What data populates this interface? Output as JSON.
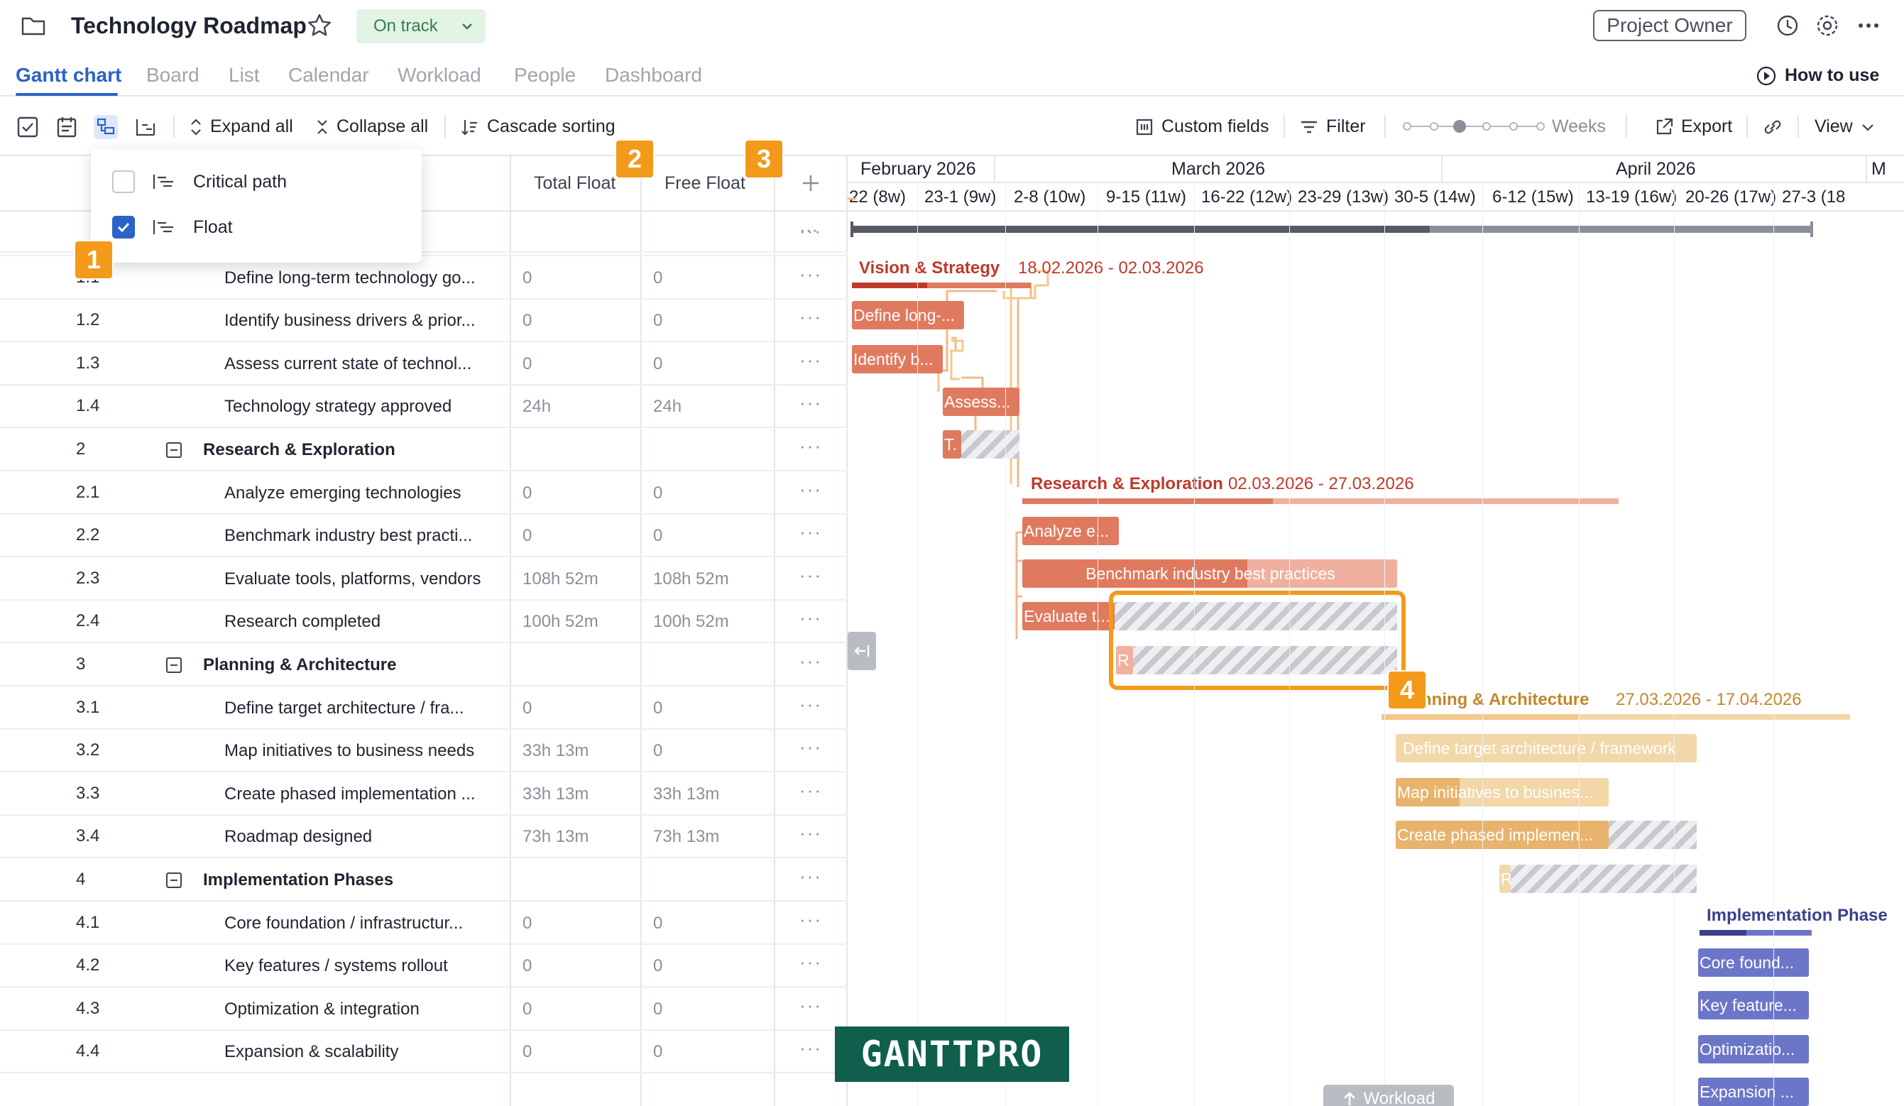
{
  "header": {
    "title": "Technology Roadmap",
    "status": "On track",
    "owner_button": "Project Owner"
  },
  "tabs": [
    "Gantt chart",
    "Board",
    "List",
    "Calendar",
    "Workload",
    "People",
    "Dashboard"
  ],
  "how_to_use": "How to use",
  "toolbar": {
    "expand_all": "Expand all",
    "collapse_all": "Collapse all",
    "cascade_sorting": "Cascade sorting",
    "custom_fields": "Custom fields",
    "filter": "Filter",
    "zoom_label": "Weeks",
    "export": "Export",
    "view": "View"
  },
  "dropdown": {
    "items": [
      {
        "label": "Critical path",
        "checked": false
      },
      {
        "label": "Float",
        "checked": true
      }
    ]
  },
  "columns": {
    "total_float": "Total Float",
    "free_float": "Free Float"
  },
  "badges": [
    "1",
    "2",
    "3",
    "4"
  ],
  "rows": [
    {
      "num": "",
      "name": "Vision & Strategy",
      "group": true,
      "tf": "",
      "ff": ""
    },
    {
      "num": "1.1",
      "name": "Define long-term technology go...",
      "group": false,
      "tf": "0",
      "ff": "0"
    },
    {
      "num": "1.2",
      "name": "Identify business drivers & prior...",
      "group": false,
      "tf": "0",
      "ff": "0"
    },
    {
      "num": "1.3",
      "name": "Assess current state of technol...",
      "group": false,
      "tf": "0",
      "ff": "0"
    },
    {
      "num": "1.4",
      "name": "Technology strategy approved",
      "group": false,
      "tf": "24h",
      "ff": "24h"
    },
    {
      "num": "2",
      "name": "Research & Exploration",
      "group": true,
      "tf": "",
      "ff": ""
    },
    {
      "num": "2.1",
      "name": "Analyze emerging technologies",
      "group": false,
      "tf": "0",
      "ff": "0"
    },
    {
      "num": "2.2",
      "name": "Benchmark industry best practi...",
      "group": false,
      "tf": "0",
      "ff": "0"
    },
    {
      "num": "2.3",
      "name": "Evaluate tools, platforms, vendors",
      "group": false,
      "tf": "108h 52m",
      "ff": "108h 52m"
    },
    {
      "num": "2.4",
      "name": "Research completed",
      "group": false,
      "tf": "100h 52m",
      "ff": "100h 52m"
    },
    {
      "num": "3",
      "name": "Planning & Architecture",
      "group": true,
      "tf": "",
      "ff": ""
    },
    {
      "num": "3.1",
      "name": "Define target architecture / fra...",
      "group": false,
      "tf": "0",
      "ff": "0"
    },
    {
      "num": "3.2",
      "name": "Map initiatives to business needs",
      "group": false,
      "tf": "33h 13m",
      "ff": "0"
    },
    {
      "num": "3.3",
      "name": "Create phased implementation ...",
      "group": false,
      "tf": "33h 13m",
      "ff": "33h 13m"
    },
    {
      "num": "3.4",
      "name": "Roadmap designed",
      "group": false,
      "tf": "73h 13m",
      "ff": "73h 13m"
    },
    {
      "num": "4",
      "name": "Implementation Phases",
      "group": true,
      "tf": "",
      "ff": ""
    },
    {
      "num": "4.1",
      "name": "Core foundation / infrastructur...",
      "group": false,
      "tf": "0",
      "ff": "0"
    },
    {
      "num": "4.2",
      "name": "Key features / systems rollout",
      "group": false,
      "tf": "0",
      "ff": "0"
    },
    {
      "num": "4.3",
      "name": "Optimization & integration",
      "group": false,
      "tf": "0",
      "ff": "0"
    },
    {
      "num": "4.4",
      "name": "Expansion & scalability",
      "group": false,
      "tf": "0",
      "ff": "0"
    }
  ],
  "timeline": {
    "months": [
      "February 2026",
      "March 2026",
      "April 2026",
      "M"
    ],
    "weeks": [
      "22 (8w)",
      "23-1 (9w)",
      "2-8 (10w)",
      "9-15 (11w)",
      "16-22 (12w)",
      "23-29 (13w)",
      "30-5 (14w)",
      "6-12 (15w)",
      "13-19 (16w)",
      "20-26 (17w)",
      "27-3 (18"
    ]
  },
  "gantt": {
    "groups": [
      {
        "label": "Vision & Strategy",
        "dates": "18.02.2026 - 02.03.2026",
        "color": "#c0392b"
      },
      {
        "label": "Research & Exploration",
        "dates": "02.03.2026 - 27.03.2026",
        "color": "#c0392b"
      },
      {
        "label": "nning & Architecture",
        "dates": "27.03.2026 - 17.04.2026",
        "color": "#c2862c"
      },
      {
        "label": "Implementation Phase",
        "dates": "",
        "color": "#3d3f8f"
      }
    ],
    "tasks": [
      "Define long-...",
      "Identify b...",
      "Assess...",
      "T.",
      "Analyze e...",
      "Benchmark industry best practices",
      "Evaluate t...",
      "R",
      "Define target architecture / framework",
      "Map initiatives to busines...",
      "Create phased implemen...",
      "R",
      "Core found...",
      "Key feature...",
      "Optimizatio...",
      "Expansion ..."
    ]
  },
  "workload_button": "Workload",
  "logo": "GANTTPRO",
  "colors": {
    "accent": "#2b63c6",
    "badge": "#f39a1b",
    "vision": "#e07a5f",
    "planning": "#f2c98a",
    "implementation": "#6c76c9"
  }
}
